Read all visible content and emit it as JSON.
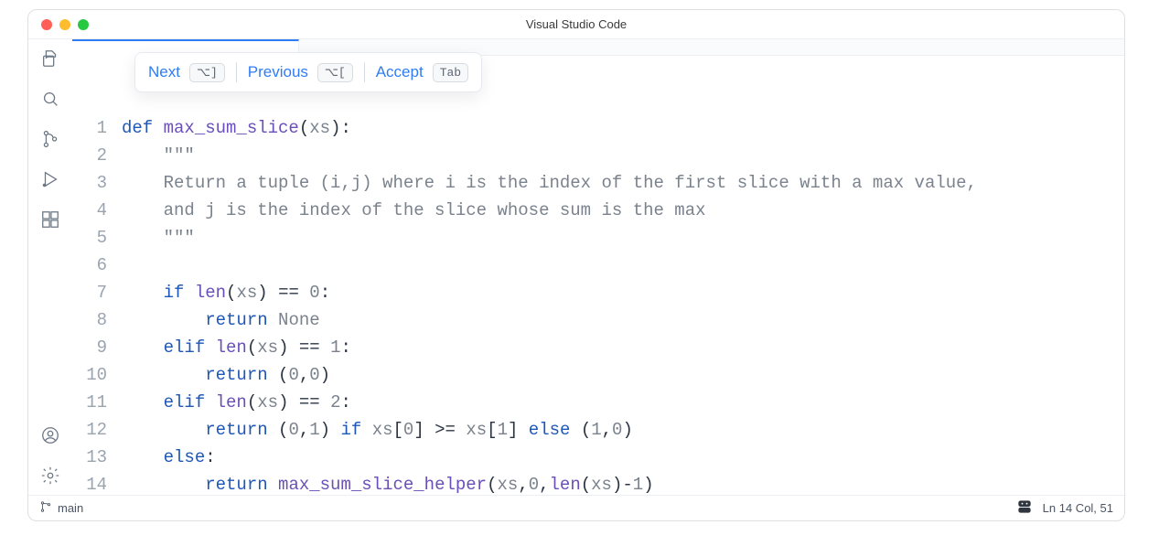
{
  "window": {
    "title": "Visual Studio Code"
  },
  "suggest": {
    "next": "Next",
    "next_key": "⌥]",
    "prev": "Previous",
    "prev_key": "⌥[",
    "accept": "Accept",
    "accept_key": "Tab"
  },
  "activity_icons": {
    "explorer": "explorer-icon",
    "search": "search-icon",
    "scm": "source-control-icon",
    "debug": "run-debug-icon",
    "extensions": "extensions-icon",
    "account": "account-icon",
    "settings": "gear-icon"
  },
  "code": {
    "lines": [
      {
        "n": 1,
        "tokens": [
          [
            "kw",
            "def "
          ],
          [
            "fn",
            "max_sum_slice"
          ],
          [
            "paren",
            "("
          ],
          [
            "var",
            "xs"
          ],
          [
            "paren",
            ")"
          ],
          [
            "colon",
            ":"
          ]
        ]
      },
      {
        "n": 2,
        "tokens": [
          [
            "plain",
            "    "
          ],
          [
            "doc",
            "\"\"\""
          ]
        ]
      },
      {
        "n": 3,
        "tokens": [
          [
            "plain",
            "    "
          ],
          [
            "doc",
            "Return a tuple (i,j) where i is the index of the first slice with a max value,"
          ]
        ]
      },
      {
        "n": 4,
        "tokens": [
          [
            "plain",
            "    "
          ],
          [
            "doc",
            "and j is the index of the slice whose sum is the max"
          ]
        ]
      },
      {
        "n": 5,
        "tokens": [
          [
            "plain",
            "    "
          ],
          [
            "doc",
            "\"\"\""
          ]
        ]
      },
      {
        "n": 6,
        "tokens": [
          [
            "plain",
            ""
          ]
        ]
      },
      {
        "n": 7,
        "tokens": [
          [
            "plain",
            "    "
          ],
          [
            "kw",
            "if"
          ],
          [
            "plain",
            " "
          ],
          [
            "fn",
            "len"
          ],
          [
            "paren",
            "("
          ],
          [
            "var",
            "xs"
          ],
          [
            "paren",
            ")"
          ],
          [
            "plain",
            " "
          ],
          [
            "op",
            "=="
          ],
          [
            "plain",
            " "
          ],
          [
            "num",
            "0"
          ],
          [
            "colon",
            ":"
          ]
        ]
      },
      {
        "n": 8,
        "tokens": [
          [
            "plain",
            "        "
          ],
          [
            "kw",
            "return"
          ],
          [
            "plain",
            " "
          ],
          [
            "var",
            "None"
          ]
        ]
      },
      {
        "n": 9,
        "tokens": [
          [
            "plain",
            "    "
          ],
          [
            "kw",
            "elif"
          ],
          [
            "plain",
            " "
          ],
          [
            "fn",
            "len"
          ],
          [
            "paren",
            "("
          ],
          [
            "var",
            "xs"
          ],
          [
            "paren",
            ")"
          ],
          [
            "plain",
            " "
          ],
          [
            "op",
            "=="
          ],
          [
            "plain",
            " "
          ],
          [
            "num",
            "1"
          ],
          [
            "colon",
            ":"
          ]
        ]
      },
      {
        "n": 10,
        "tokens": [
          [
            "plain",
            "        "
          ],
          [
            "kw",
            "return"
          ],
          [
            "plain",
            " "
          ],
          [
            "paren",
            "("
          ],
          [
            "num",
            "0"
          ],
          [
            "punc",
            ","
          ],
          [
            "num",
            "0"
          ],
          [
            "paren",
            ")"
          ]
        ]
      },
      {
        "n": 11,
        "tokens": [
          [
            "plain",
            "    "
          ],
          [
            "kw",
            "elif"
          ],
          [
            "plain",
            " "
          ],
          [
            "fn",
            "len"
          ],
          [
            "paren",
            "("
          ],
          [
            "var",
            "xs"
          ],
          [
            "paren",
            ")"
          ],
          [
            "plain",
            " "
          ],
          [
            "op",
            "=="
          ],
          [
            "plain",
            " "
          ],
          [
            "num",
            "2"
          ],
          [
            "colon",
            ":"
          ]
        ]
      },
      {
        "n": 12,
        "tokens": [
          [
            "plain",
            "        "
          ],
          [
            "kw",
            "return"
          ],
          [
            "plain",
            " "
          ],
          [
            "paren",
            "("
          ],
          [
            "num",
            "0"
          ],
          [
            "punc",
            ","
          ],
          [
            "num",
            "1"
          ],
          [
            "paren",
            ")"
          ],
          [
            "plain",
            " "
          ],
          [
            "kw",
            "if"
          ],
          [
            "plain",
            " "
          ],
          [
            "var",
            "xs"
          ],
          [
            "paren",
            "["
          ],
          [
            "num",
            "0"
          ],
          [
            "paren",
            "]"
          ],
          [
            "plain",
            " "
          ],
          [
            "op",
            ">="
          ],
          [
            "plain",
            " "
          ],
          [
            "var",
            "xs"
          ],
          [
            "paren",
            "["
          ],
          [
            "num",
            "1"
          ],
          [
            "paren",
            "]"
          ],
          [
            "plain",
            " "
          ],
          [
            "kw",
            "else"
          ],
          [
            "plain",
            " "
          ],
          [
            "paren",
            "("
          ],
          [
            "num",
            "1"
          ],
          [
            "punc",
            ","
          ],
          [
            "num",
            "0"
          ],
          [
            "paren",
            ")"
          ]
        ]
      },
      {
        "n": 13,
        "tokens": [
          [
            "plain",
            "    "
          ],
          [
            "kw",
            "else"
          ],
          [
            "colon",
            ":"
          ]
        ]
      },
      {
        "n": 14,
        "tokens": [
          [
            "plain",
            "        "
          ],
          [
            "kw",
            "return"
          ],
          [
            "plain",
            " "
          ],
          [
            "fn",
            "max_sum_slice_helper"
          ],
          [
            "paren",
            "("
          ],
          [
            "var",
            "xs"
          ],
          [
            "punc",
            ","
          ],
          [
            "num",
            "0"
          ],
          [
            "punc",
            ","
          ],
          [
            "fn",
            "len"
          ],
          [
            "paren",
            "("
          ],
          [
            "var",
            "xs"
          ],
          [
            "paren",
            ")"
          ],
          [
            "op",
            "-"
          ],
          [
            "num",
            "1"
          ],
          [
            "paren",
            ")"
          ]
        ]
      }
    ]
  },
  "status": {
    "branch": "main",
    "lncol": "Ln 14 Col, 51"
  }
}
